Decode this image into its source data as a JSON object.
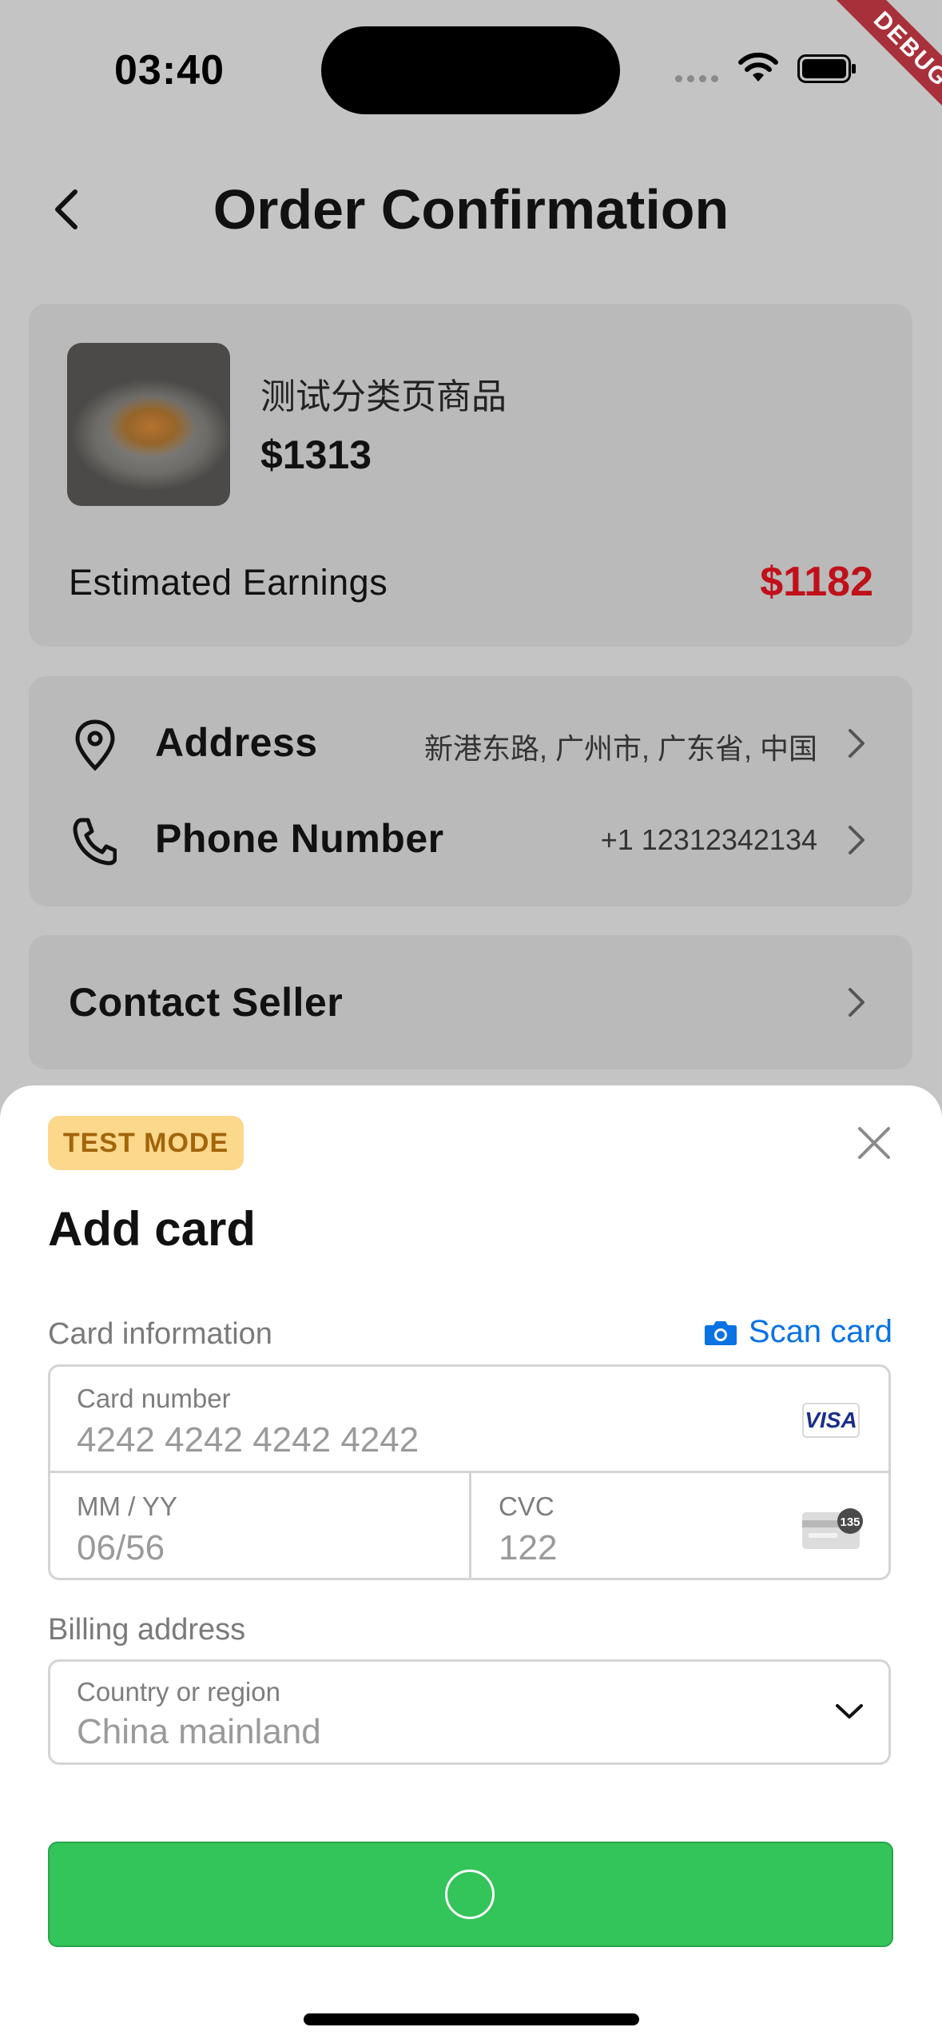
{
  "status_bar": {
    "time": "03:40",
    "debug_label": "DEBUG"
  },
  "header": {
    "title": "Order Confirmation"
  },
  "product": {
    "name": "测试分类页商品",
    "price": "$1313"
  },
  "earnings": {
    "label": "Estimated Earnings",
    "value": "$1182",
    "value_color": "#c0111a"
  },
  "info": {
    "address": {
      "label": "Address",
      "value": "新港东路, 广州市, 广东省, 中国"
    },
    "phone": {
      "label": "Phone Number",
      "value": "+1 12312342134"
    }
  },
  "contact": {
    "label": "Contact Seller"
  },
  "sheet": {
    "badge": "TEST MODE",
    "title": "Add card",
    "card_info_label": "Card information",
    "scan_card": "Scan card",
    "card_number": {
      "label": "Card number",
      "value": "4242 4242 4242 4242",
      "brand": "VISA"
    },
    "expiry": {
      "label": "MM / YY",
      "value": "06/56"
    },
    "cvc": {
      "label": "CVC",
      "value": "122",
      "icon_text": "135"
    },
    "billing_label": "Billing address",
    "country": {
      "label": "Country or region",
      "value": "China mainland"
    },
    "pay_button_color": "#33c45a",
    "accent_color": "#0a72e3"
  }
}
